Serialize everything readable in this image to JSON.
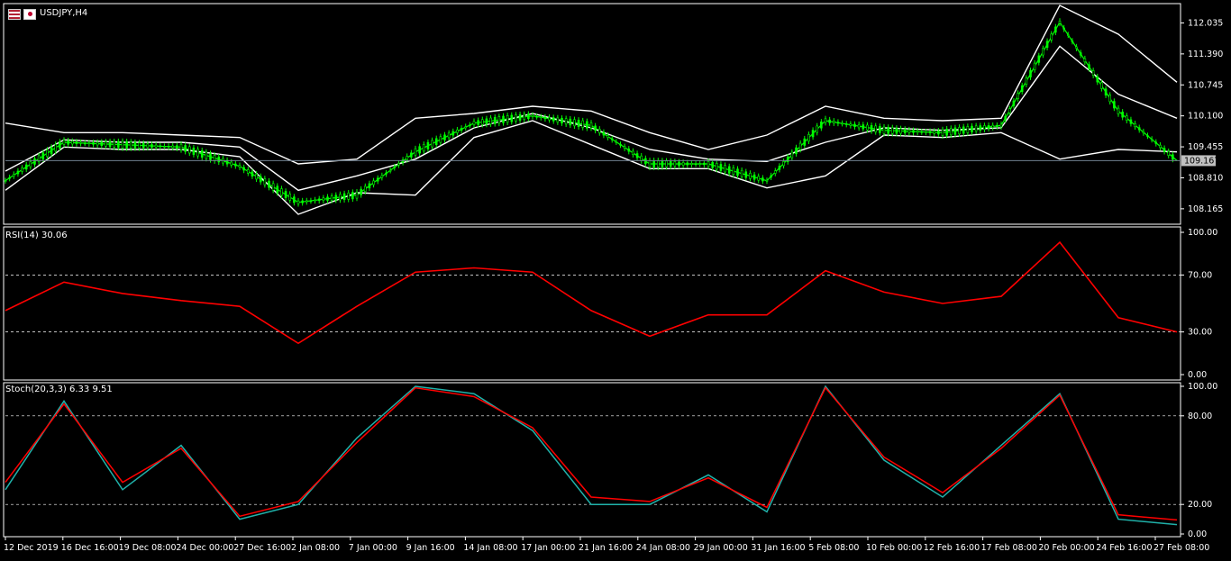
{
  "window": {
    "symbol_title": "USDJPY,H4"
  },
  "colors": {
    "background": "#000000",
    "grid": "#ffffff",
    "candle_up": "#00ff00",
    "candle_down": "#00ff00",
    "bollinger": "#ffffff",
    "rsi_line": "#ff0000",
    "stoch_main": "#20b2aa",
    "stoch_signal": "#ff0000",
    "current_price_line": "#708090"
  },
  "panes": {
    "price": {
      "label": "USDJPY,H4",
      "current_price": "109.167",
      "y_ticks": [
        "112.035",
        "111.390",
        "110.745",
        "110.100",
        "109.455",
        "108.810",
        "108.165"
      ]
    },
    "rsi": {
      "label": "RSI(14) 30.06",
      "y_ticks": [
        "100.00",
        "70.00",
        "30.00",
        "0.00"
      ]
    },
    "stoch": {
      "label": "Stoch(20,3,3) 6.33 9.51",
      "y_ticks": [
        "100.00",
        "80.00",
        "20.00",
        "0.00"
      ]
    }
  },
  "time_axis": [
    "12 Dec 2019",
    "16 Dec 16:00",
    "19 Dec 08:00",
    "24 Dec 00:00",
    "27 Dec 16:00",
    "2 Jan 08:00",
    "7 Jan 00:00",
    "9 Jan 16:00",
    "14 Jan 08:00",
    "17 Jan 00:00",
    "21 Jan 16:00",
    "24 Jan 08:00",
    "29 Jan 00:00",
    "31 Jan 16:00",
    "5 Feb 08:00",
    "10 Feb 00:00",
    "12 Feb 16:00",
    "17 Feb 08:00",
    "20 Feb 00:00",
    "24 Feb 16:00",
    "27 Feb 08:00"
  ],
  "chart_data": [
    {
      "type": "line",
      "title": "USDJPY,H4",
      "subtype": "candlestick with Bollinger Bands",
      "ylim": [
        107.9,
        112.4
      ],
      "x": [
        "12 Dec 2019",
        "16 Dec 16:00",
        "19 Dec 08:00",
        "24 Dec 00:00",
        "27 Dec 16:00",
        "2 Jan 08:00",
        "7 Jan 00:00",
        "9 Jan 16:00",
        "14 Jan 08:00",
        "17 Jan 00:00",
        "21 Jan 16:00",
        "24 Jan 08:00",
        "29 Jan 00:00",
        "31 Jan 16:00",
        "5 Feb 08:00",
        "10 Feb 00:00",
        "12 Feb 16:00",
        "17 Feb 08:00",
        "20 Feb 00:00",
        "24 Feb 16:00",
        "27 Feb 08:00"
      ],
      "series": [
        {
          "values": [
            108.75,
            109.55,
            109.5,
            109.45,
            109.05,
            108.3,
            108.45,
            109.35,
            109.95,
            110.1,
            109.9,
            109.1,
            109.1,
            108.75,
            110.0,
            109.8,
            109.75,
            109.9,
            112.05,
            110.2,
            109.17
          ]
        },
        {
          "values": [
            108.95,
            109.6,
            109.55,
            109.55,
            109.45,
            108.55,
            108.85,
            109.2,
            109.85,
            110.15,
            109.85,
            109.4,
            109.2,
            109.15,
            109.55,
            109.85,
            109.8,
            109.85,
            111.55,
            110.55,
            110.05
          ]
        },
        {
          "values": [
            109.95,
            109.75,
            109.75,
            109.7,
            109.65,
            109.1,
            109.2,
            110.05,
            110.15,
            110.3,
            110.2,
            109.75,
            109.4,
            109.7,
            110.3,
            110.05,
            110.0,
            110.05,
            112.4,
            111.8,
            110.8
          ]
        },
        {
          "values": [
            108.55,
            109.45,
            109.4,
            109.4,
            109.25,
            108.05,
            108.5,
            108.45,
            109.65,
            110.0,
            109.5,
            109.0,
            109.0,
            108.6,
            108.85,
            109.7,
            109.65,
            109.75,
            109.2,
            109.4,
            109.35
          ]
        }
      ]
    },
    {
      "type": "line",
      "title": "RSI(14) 30.06",
      "ylim": [
        0,
        100
      ],
      "x": [
        "12 Dec 2019",
        "16 Dec 16:00",
        "19 Dec 08:00",
        "24 Dec 00:00",
        "27 Dec 16:00",
        "2 Jan 08:00",
        "7 Jan 00:00",
        "9 Jan 16:00",
        "14 Jan 08:00",
        "17 Jan 00:00",
        "21 Jan 16:00",
        "24 Jan 08:00",
        "29 Jan 00:00",
        "31 Jan 16:00",
        "5 Feb 08:00",
        "10 Feb 00:00",
        "12 Feb 16:00",
        "17 Feb 08:00",
        "20 Feb 00:00",
        "24 Feb 16:00",
        "27 Feb 08:00"
      ],
      "series": [
        {
          "values": [
            45,
            65,
            57,
            52,
            48,
            22,
            48,
            72,
            75,
            72,
            45,
            27,
            42,
            42,
            73,
            58,
            50,
            55,
            93,
            40,
            30
          ]
        }
      ]
    },
    {
      "type": "line",
      "title": "Stoch(20,3,3) 6.33 9.51",
      "ylim": [
        0,
        100
      ],
      "x": [
        "12 Dec 2019",
        "16 Dec 16:00",
        "19 Dec 08:00",
        "24 Dec 00:00",
        "27 Dec 16:00",
        "2 Jan 08:00",
        "7 Jan 00:00",
        "9 Jan 16:00",
        "14 Jan 08:00",
        "17 Jan 00:00",
        "21 Jan 16:00",
        "24 Jan 08:00",
        "29 Jan 00:00",
        "31 Jan 16:00",
        "5 Feb 08:00",
        "10 Feb 00:00",
        "12 Feb 16:00",
        "17 Feb 08:00",
        "20 Feb 00:00",
        "24 Feb 16:00",
        "27 Feb 08:00"
      ],
      "series": [
        {
          "values": [
            30,
            90,
            30,
            60,
            10,
            20,
            65,
            100,
            95,
            70,
            20,
            20,
            40,
            15,
            100,
            50,
            25,
            60,
            95,
            10,
            6.33
          ]
        },
        {
          "values": [
            35,
            88,
            35,
            58,
            12,
            22,
            62,
            99,
            93,
            72,
            25,
            22,
            38,
            18,
            99,
            52,
            28,
            58,
            94,
            13,
            9.51
          ]
        }
      ]
    }
  ]
}
